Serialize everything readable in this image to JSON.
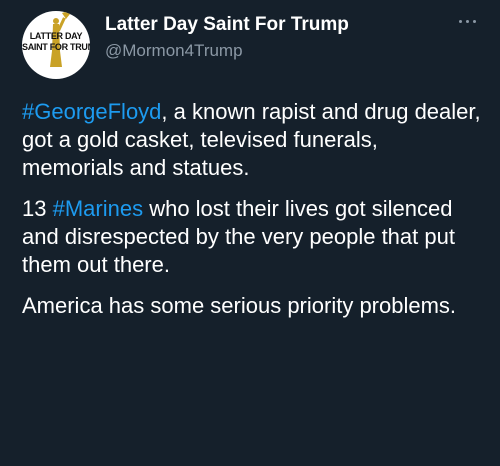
{
  "author": {
    "display_name": "Latter Day Saint For Trump",
    "handle": "@Mormon4Trump",
    "avatar": {
      "line1": "LATTER DAY",
      "line2": "SAINT FOR TRUMP"
    }
  },
  "tweet": {
    "p1": {
      "hashtag": "#GeorgeFloyd",
      "text": ", a known rapist and drug dealer, got a gold casket, televised funerals, memorials and statues."
    },
    "p2": {
      "prefix": "13 ",
      "hashtag": "#Marines",
      "text": " who lost their lives got silenced and disrespected by the very people that put them out there."
    },
    "p3": {
      "text": "America has some serious priority problems."
    }
  },
  "colors": {
    "background": "#15202b",
    "hashtag": "#1d9bf0",
    "secondary_text": "#8b98a5"
  },
  "icons": {
    "more": "more-options-icon"
  }
}
